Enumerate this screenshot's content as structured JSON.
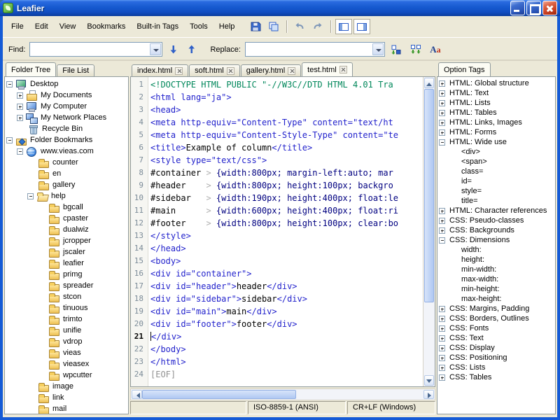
{
  "window": {
    "title": "Leafier"
  },
  "menu_bar": {
    "items": [
      "File",
      "Edit",
      "View",
      "Bookmarks",
      "Built-in Tags",
      "Tools",
      "Help"
    ]
  },
  "find_bar": {
    "find_label": "Find:",
    "find_value": "",
    "replace_label": "Replace:",
    "replace_value": "",
    "font_icon_A": "A",
    "font_icon_a": "a"
  },
  "left_panel": {
    "tabs": [
      {
        "label": "Folder Tree",
        "active": true
      },
      {
        "label": "File List",
        "active": false
      }
    ],
    "tree": [
      {
        "depth": 0,
        "label": "Desktop",
        "icon": "desktop",
        "exp": "minus"
      },
      {
        "depth": 1,
        "label": "My Documents",
        "icon": "documents",
        "exp": "plus"
      },
      {
        "depth": 1,
        "label": "My Computer",
        "icon": "computer",
        "exp": "plus"
      },
      {
        "depth": 1,
        "label": "My Network Places",
        "icon": "network",
        "exp": "plus"
      },
      {
        "depth": 1,
        "label": "Recycle Bin",
        "icon": "recycle",
        "exp": null
      },
      {
        "depth": 0,
        "label": "Folder Bookmarks",
        "icon": "bookmarks",
        "exp": "minus"
      },
      {
        "depth": 1,
        "label": "www.vieas.com",
        "icon": "site",
        "exp": "minus"
      },
      {
        "depth": 2,
        "label": "counter",
        "icon": "folder",
        "exp": null
      },
      {
        "depth": 2,
        "label": "en",
        "icon": "folder",
        "exp": null
      },
      {
        "depth": 2,
        "label": "gallery",
        "icon": "folder",
        "exp": null
      },
      {
        "depth": 2,
        "label": "help",
        "icon": "folder-open",
        "exp": "minus"
      },
      {
        "depth": 3,
        "label": "bgcall",
        "icon": "folder",
        "exp": null
      },
      {
        "depth": 3,
        "label": "cpaster",
        "icon": "folder",
        "exp": null
      },
      {
        "depth": 3,
        "label": "dualwiz",
        "icon": "folder",
        "exp": null
      },
      {
        "depth": 3,
        "label": "jcropper",
        "icon": "folder",
        "exp": null
      },
      {
        "depth": 3,
        "label": "jscaler",
        "icon": "folder",
        "exp": null
      },
      {
        "depth": 3,
        "label": "leafier",
        "icon": "folder",
        "exp": null
      },
      {
        "depth": 3,
        "label": "primg",
        "icon": "folder",
        "exp": null
      },
      {
        "depth": 3,
        "label": "spreader",
        "icon": "folder",
        "exp": null
      },
      {
        "depth": 3,
        "label": "stcon",
        "icon": "folder",
        "exp": null
      },
      {
        "depth": 3,
        "label": "tinuous",
        "icon": "folder",
        "exp": null
      },
      {
        "depth": 3,
        "label": "trimto",
        "icon": "folder",
        "exp": null
      },
      {
        "depth": 3,
        "label": "unifie",
        "icon": "folder",
        "exp": null
      },
      {
        "depth": 3,
        "label": "vdrop",
        "icon": "folder",
        "exp": null
      },
      {
        "depth": 3,
        "label": "vieas",
        "icon": "folder",
        "exp": null
      },
      {
        "depth": 3,
        "label": "vieasex",
        "icon": "folder",
        "exp": null
      },
      {
        "depth": 3,
        "label": "wpcutter",
        "icon": "folder",
        "exp": null
      },
      {
        "depth": 2,
        "label": "image",
        "icon": "folder",
        "exp": null
      },
      {
        "depth": 2,
        "label": "link",
        "icon": "folder",
        "exp": null
      },
      {
        "depth": 2,
        "label": "mail",
        "icon": "folder",
        "exp": null
      }
    ]
  },
  "editor": {
    "tabs": [
      {
        "label": "index.html",
        "active": false
      },
      {
        "label": "soft.html",
        "active": false
      },
      {
        "label": "gallery.html",
        "active": false
      },
      {
        "label": "test.html",
        "active": true
      }
    ],
    "lines": [
      {
        "n": 1,
        "segs": [
          [
            "doc",
            "<!DOCTYPE HTML PUBLIC \"-//W3C//DTD HTML 4.01 Tra"
          ]
        ]
      },
      {
        "n": 2,
        "segs": [
          [
            "tag",
            "<html lang=\"ja\">"
          ]
        ]
      },
      {
        "n": 3,
        "segs": [
          [
            "tag",
            "<head>"
          ]
        ]
      },
      {
        "n": 4,
        "segs": [
          [
            "tag",
            "<meta http-equiv=\"Content-Type\" content=\"text/ht"
          ]
        ]
      },
      {
        "n": 5,
        "segs": [
          [
            "tag",
            "<meta http-equiv=\"Content-Style-Type\" content=\"te"
          ]
        ]
      },
      {
        "n": 6,
        "segs": [
          [
            "tag",
            "<title>"
          ],
          [
            "txt",
            "Example of column"
          ],
          [
            "tag",
            "</title>"
          ]
        ]
      },
      {
        "n": 7,
        "segs": [
          [
            "tag",
            "<style type=\"text/css\">"
          ]
        ]
      },
      {
        "n": 8,
        "segs": [
          [
            "sel",
            "#container"
          ],
          [
            "ws",
            " > "
          ],
          [
            "css",
            "{width:800px; margin-left:auto; mar"
          ]
        ]
      },
      {
        "n": 9,
        "segs": [
          [
            "sel",
            "#header"
          ],
          [
            "ws",
            "    > "
          ],
          [
            "css",
            "{width:800px; height:100px; backgro"
          ]
        ]
      },
      {
        "n": 10,
        "segs": [
          [
            "sel",
            "#sidebar"
          ],
          [
            "ws",
            "   > "
          ],
          [
            "css",
            "{width:190px; height:400px; float:le"
          ]
        ]
      },
      {
        "n": 11,
        "segs": [
          [
            "sel",
            "#main"
          ],
          [
            "ws",
            "      > "
          ],
          [
            "css",
            "{width:600px; height:400px; float:ri"
          ]
        ]
      },
      {
        "n": 12,
        "segs": [
          [
            "sel",
            "#footer"
          ],
          [
            "ws",
            "    > "
          ],
          [
            "css",
            "{width:800px; height:100px; clear:bo"
          ]
        ]
      },
      {
        "n": 13,
        "segs": [
          [
            "tag",
            "</style>"
          ]
        ]
      },
      {
        "n": 14,
        "segs": [
          [
            "tag",
            "</head>"
          ]
        ]
      },
      {
        "n": 15,
        "segs": [
          [
            "tag",
            "<body>"
          ]
        ]
      },
      {
        "n": 16,
        "segs": [
          [
            "tag",
            "<div id=\"container\">"
          ]
        ]
      },
      {
        "n": 17,
        "segs": [
          [
            "tag",
            "<div id=\"header\">"
          ],
          [
            "txt",
            "header"
          ],
          [
            "tag",
            "</div>"
          ]
        ]
      },
      {
        "n": 18,
        "segs": [
          [
            "tag",
            "<div id=\"sidebar\">"
          ],
          [
            "txt",
            "sidebar"
          ],
          [
            "tag",
            "</div>"
          ]
        ]
      },
      {
        "n": 19,
        "segs": [
          [
            "tag",
            "<div id=\"main\">"
          ],
          [
            "txt",
            "main"
          ],
          [
            "tag",
            "</div>"
          ]
        ]
      },
      {
        "n": 20,
        "segs": [
          [
            "tag",
            "<div id=\"footer\">"
          ],
          [
            "txt",
            "footer"
          ],
          [
            "tag",
            "</div>"
          ]
        ]
      },
      {
        "n": 21,
        "segs": [
          [
            "tag",
            "</div>"
          ]
        ],
        "caret": true
      },
      {
        "n": 22,
        "segs": [
          [
            "tag",
            "</body>"
          ]
        ]
      },
      {
        "n": 23,
        "segs": [
          [
            "tag",
            "</html>"
          ]
        ]
      },
      {
        "n": 24,
        "segs": [
          [
            "eof",
            "[EOF]"
          ]
        ]
      }
    ],
    "status": {
      "left": "",
      "encoding": "ISO-8859-1 (ANSI)",
      "line_ending": "CR+LF (Windows)"
    }
  },
  "right_panel": {
    "tab": "Option Tags",
    "tree": [
      {
        "depth": 0,
        "label": "HTML: Global structure",
        "icon": null,
        "exp": "plus"
      },
      {
        "depth": 0,
        "label": "HTML: Text",
        "icon": null,
        "exp": "plus"
      },
      {
        "depth": 0,
        "label": "HTML: Lists",
        "icon": null,
        "exp": "plus"
      },
      {
        "depth": 0,
        "label": "HTML: Tables",
        "icon": null,
        "exp": "plus"
      },
      {
        "depth": 0,
        "label": "HTML: Links, Images",
        "icon": null,
        "exp": "plus"
      },
      {
        "depth": 0,
        "label": "HTML: Forms",
        "icon": null,
        "exp": "plus"
      },
      {
        "depth": 0,
        "label": "HTML: Wide use",
        "icon": null,
        "exp": "minus"
      },
      {
        "depth": 1,
        "label": "<div>",
        "icon": null,
        "exp": null
      },
      {
        "depth": 1,
        "label": "<span>",
        "icon": null,
        "exp": null
      },
      {
        "depth": 1,
        "label": "class=",
        "icon": null,
        "exp": null
      },
      {
        "depth": 1,
        "label": "id=",
        "icon": null,
        "exp": null
      },
      {
        "depth": 1,
        "label": "style=",
        "icon": null,
        "exp": null
      },
      {
        "depth": 1,
        "label": "title=",
        "icon": null,
        "exp": null
      },
      {
        "depth": 0,
        "label": "HTML: Character references",
        "icon": null,
        "exp": "plus"
      },
      {
        "depth": 0,
        "label": "CSS: Pseudo-classes",
        "icon": null,
        "exp": "plus"
      },
      {
        "depth": 0,
        "label": "CSS: Backgrounds",
        "icon": null,
        "exp": "plus"
      },
      {
        "depth": 0,
        "label": "CSS: Dimensions",
        "icon": null,
        "exp": "minus"
      },
      {
        "depth": 1,
        "label": "width:",
        "icon": null,
        "exp": null
      },
      {
        "depth": 1,
        "label": "height:",
        "icon": null,
        "exp": null
      },
      {
        "depth": 1,
        "label": "min-width:",
        "icon": null,
        "exp": null
      },
      {
        "depth": 1,
        "label": "max-width:",
        "icon": null,
        "exp": null
      },
      {
        "depth": 1,
        "label": "min-height:",
        "icon": null,
        "exp": null
      },
      {
        "depth": 1,
        "label": "max-height:",
        "icon": null,
        "exp": null
      },
      {
        "depth": 0,
        "label": "CSS: Margins, Padding",
        "icon": null,
        "exp": "plus"
      },
      {
        "depth": 0,
        "label": "CSS: Borders, Outlines",
        "icon": null,
        "exp": "plus"
      },
      {
        "depth": 0,
        "label": "CSS: Fonts",
        "icon": null,
        "exp": "plus"
      },
      {
        "depth": 0,
        "label": "CSS: Text",
        "icon": null,
        "exp": "plus"
      },
      {
        "depth": 0,
        "label": "CSS: Display",
        "icon": null,
        "exp": "plus"
      },
      {
        "depth": 0,
        "label": "CSS: Positioning",
        "icon": null,
        "exp": "plus"
      },
      {
        "depth": 0,
        "label": "CSS: Lists",
        "icon": null,
        "exp": "plus"
      },
      {
        "depth": 0,
        "label": "CSS: Tables",
        "icon": null,
        "exp": "plus"
      }
    ]
  }
}
